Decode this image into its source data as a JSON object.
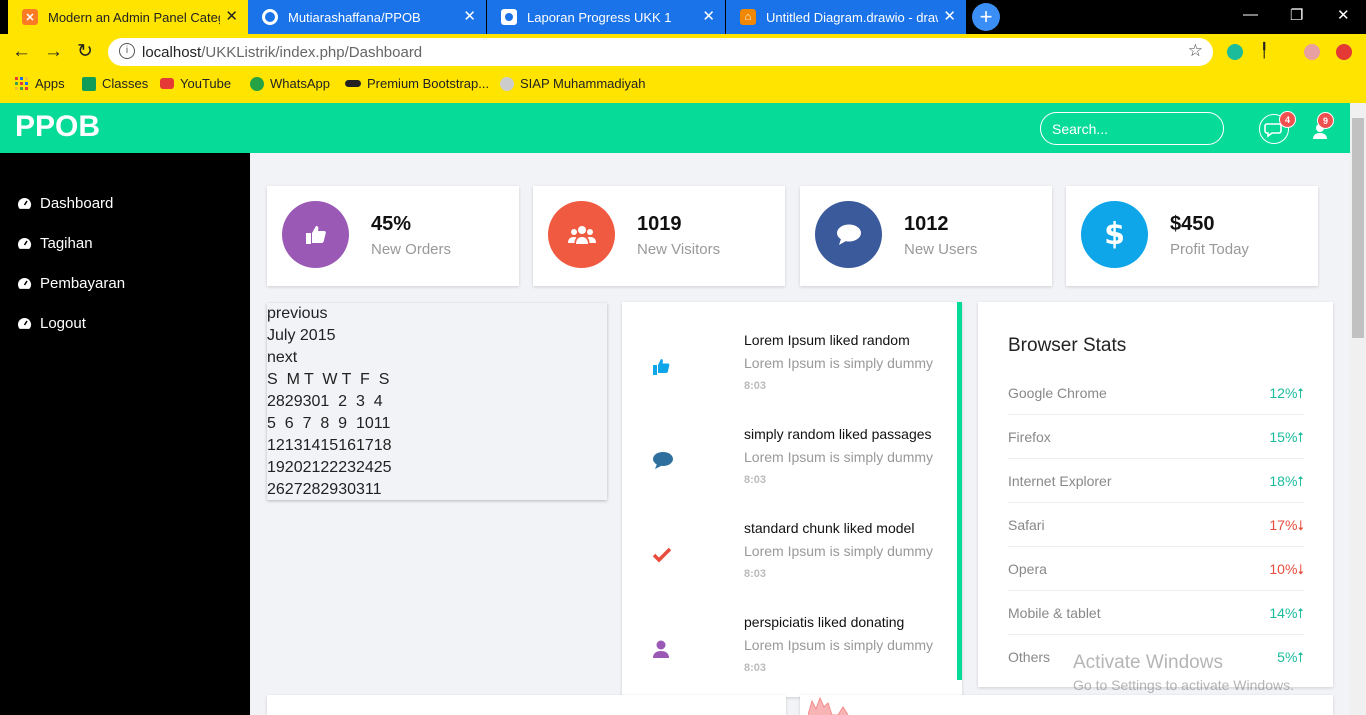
{
  "browser": {
    "tabs": [
      {
        "title": "Modern an Admin Panel Categor",
        "icon": "xampp-icon",
        "active": true
      },
      {
        "title": "Mutiarashaffana/PPOB",
        "icon": "github-icon",
        "active": false
      },
      {
        "title": "Laporan Progress UKK 1",
        "icon": "classroom-icon",
        "active": false
      },
      {
        "title": "Untitled Diagram.drawio - draw.i",
        "icon": "drawio-icon",
        "active": false
      }
    ],
    "url_host": "localhost",
    "url_path": "/UKKListrik/index.php/Dashboard",
    "bookmarks": [
      {
        "label": "Apps",
        "icon": "apps-grid-icon"
      },
      {
        "label": "Classes",
        "icon": "classroom-icon"
      },
      {
        "label": "YouTube",
        "icon": "youtube-icon"
      },
      {
        "label": "WhatsApp",
        "icon": "whatsapp-icon"
      },
      {
        "label": "Premium Bootstrap...",
        "icon": "bootstrap-icon"
      },
      {
        "label": "SIAP Muhammadiyah",
        "icon": "siap-icon"
      }
    ]
  },
  "header": {
    "brand": "PPOB",
    "search_placeholder": "Search...",
    "messages_count": "4",
    "notifications_count": "9",
    "color": "#07db98"
  },
  "sidebar": {
    "items": [
      {
        "label": "Dashboard",
        "icon": "dashboard-icon"
      },
      {
        "label": "Tagihan",
        "icon": "dashboard-icon"
      },
      {
        "label": "Pembayaran",
        "icon": "dashboard-icon"
      },
      {
        "label": "Logout",
        "icon": "dashboard-icon"
      }
    ]
  },
  "stats": [
    {
      "value": "45%",
      "label": "New Orders",
      "icon": "thumbs-up-icon",
      "color": "#9b59b6"
    },
    {
      "value": "1019",
      "label": "New Visitors",
      "icon": "users-icon",
      "color": "#f05a40"
    },
    {
      "value": "1012",
      "label": "New Users",
      "icon": "comment-icon",
      "color": "#3a5a9b"
    },
    {
      "value": "$450",
      "label": "Profit Today",
      "icon": "dollar-icon",
      "color": "#0ea5e9"
    }
  ],
  "calendar": {
    "prev": "previous",
    "month": "July 2015",
    "next": "next",
    "lines": [
      "S  M T  W T  F  S",
      "2829301  2  3  4",
      "5  6  7  8  9  1011",
      "12131415161718",
      "19202122232425",
      "2627282930311"
    ]
  },
  "activity": [
    {
      "title": "Lorem Ipsum liked random",
      "text": "Lorem Ipsum is simply dummy",
      "time": "8:03",
      "icon": "thumbs-up-icon",
      "color": "#0ea5e9"
    },
    {
      "title": "simply random liked passages",
      "text": "Lorem Ipsum is simply dummy",
      "time": "8:03",
      "icon": "comment-icon",
      "color": "#2e6f9e"
    },
    {
      "title": "standard chunk liked model",
      "text": "Lorem Ipsum is simply dummy",
      "time": "8:03",
      "icon": "check-icon",
      "color": "#e74c3c"
    },
    {
      "title": "perspiciatis liked donating",
      "text": "Lorem Ipsum is simply dummy",
      "time": "8:03",
      "icon": "user-icon",
      "color": "#9b59b6"
    }
  ],
  "browser_stats": {
    "title": "Browser Stats",
    "rows": [
      {
        "name": "Google Chrome",
        "value": "12%",
        "trend": "up"
      },
      {
        "name": "Firefox",
        "value": "15%",
        "trend": "up"
      },
      {
        "name": "Internet Explorer",
        "value": "18%",
        "trend": "up"
      },
      {
        "name": "Safari",
        "value": "17%",
        "trend": "down"
      },
      {
        "name": "Opera",
        "value": "10%",
        "trend": "down"
      },
      {
        "name": "Mobile & tablet",
        "value": "14%",
        "trend": "up"
      },
      {
        "name": "Others",
        "value": "5%",
        "trend": "up"
      }
    ]
  },
  "watermark": {
    "line1": "Activate Windows",
    "line2": "Go to Settings to activate Windows."
  }
}
